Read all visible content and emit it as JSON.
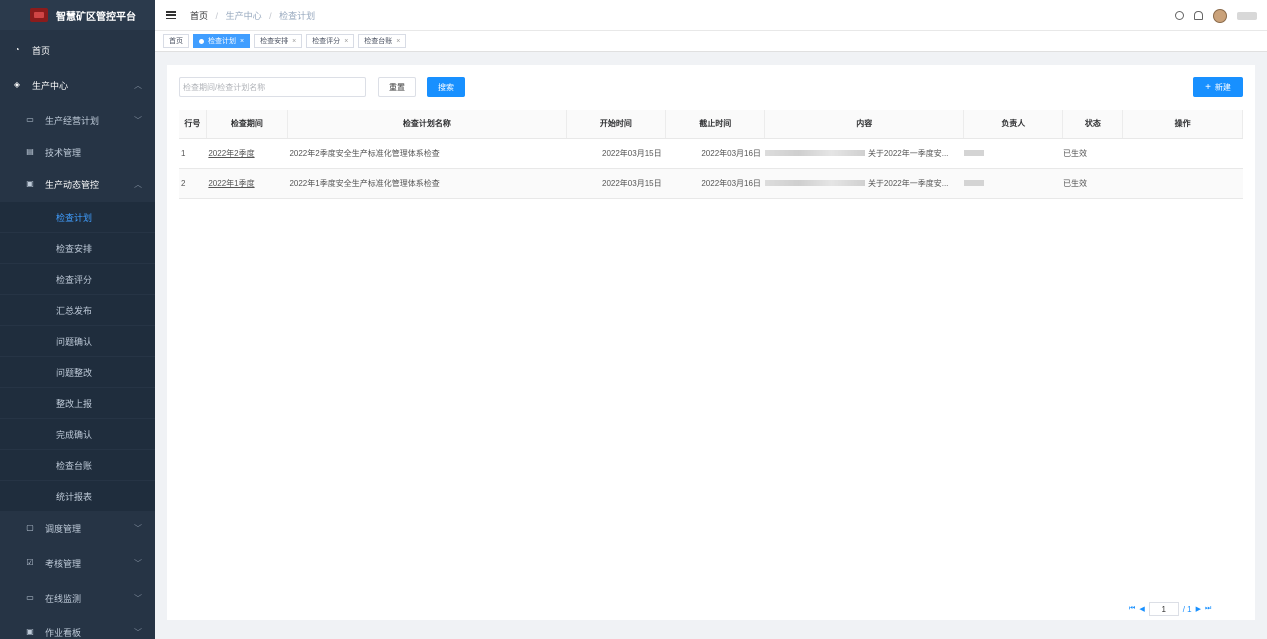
{
  "app": {
    "title": "智慧矿区管控平台"
  },
  "sidebar": {
    "home": "首页",
    "production_center": "生产中心",
    "items": [
      {
        "label": "生产经营计划"
      },
      {
        "label": "技术管理"
      },
      {
        "label": "生产动态管控"
      }
    ],
    "subitems": [
      {
        "label": "检查计划"
      },
      {
        "label": "检查安排"
      },
      {
        "label": "检查评分"
      },
      {
        "label": "汇总发布"
      },
      {
        "label": "问题确认"
      },
      {
        "label": "问题整改"
      },
      {
        "label": "整改上报"
      },
      {
        "label": "完成确认"
      },
      {
        "label": "检查台账"
      },
      {
        "label": "统计报表"
      }
    ],
    "bottom": [
      {
        "label": "调度管理"
      },
      {
        "label": "考核管理"
      },
      {
        "label": "在线监测"
      },
      {
        "label": "作业看板"
      }
    ]
  },
  "header": {
    "breadcrumb": [
      "首页",
      "生产中心",
      "检查计划"
    ]
  },
  "tabs": [
    {
      "label": "首页"
    },
    {
      "label": "检查计划"
    },
    {
      "label": "检查安排"
    },
    {
      "label": "检查评分"
    },
    {
      "label": "检查台账"
    }
  ],
  "filters": {
    "search_placeholder": "检查期间/检查计划名称",
    "reset_label": "重置",
    "search_label": "搜索",
    "new_label": "新建"
  },
  "table": {
    "columns": [
      "行号",
      "检查期间",
      "检查计划名称",
      "开始时间",
      "截止时间",
      "内容",
      "负责人",
      "状态",
      "操作"
    ],
    "rows": [
      {
        "no": "1",
        "period": "2022年2季度",
        "name": "2022年2季度安全生产标准化管理体系检查",
        "start": "2022年03月15日",
        "end": "2022年03月16日",
        "content": "关于2022年一季度安...",
        "status": "已生效"
      },
      {
        "no": "2",
        "period": "2022年1季度",
        "name": "2022年1季度安全生产标准化管理体系检查",
        "start": "2022年03月15日",
        "end": "2022年03月16日",
        "content": "关于2022年一季度安...",
        "status": "已生效"
      }
    ]
  },
  "pager": {
    "page": "1",
    "total": "/ 1"
  }
}
